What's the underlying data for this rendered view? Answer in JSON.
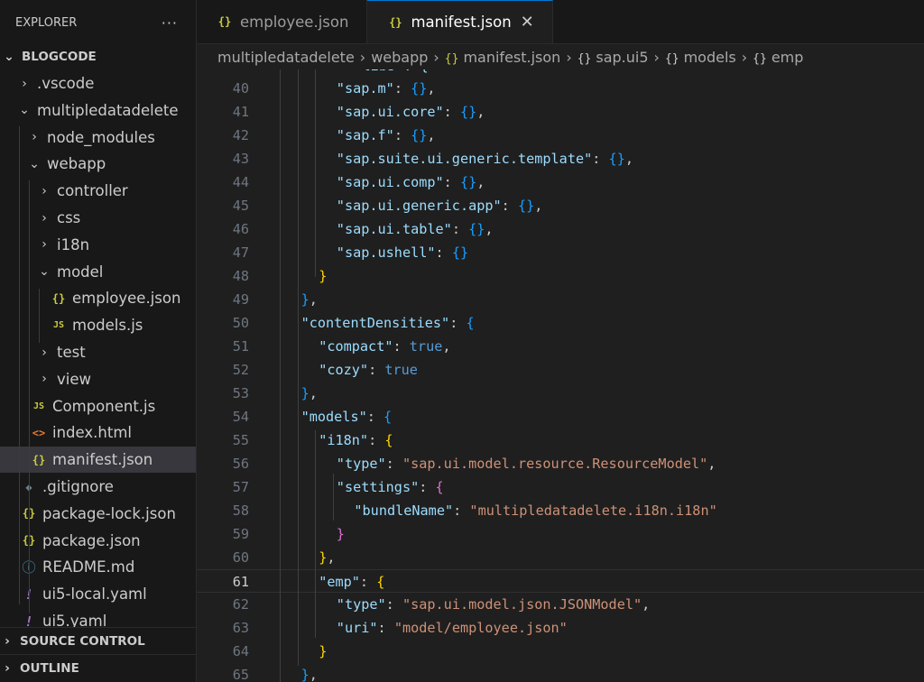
{
  "explorer": {
    "title": "EXPLORER",
    "more_label": "···",
    "root_label": "BLOGCODE",
    "items": [
      {
        "label": ".vscode",
        "kind": "folder",
        "expanded": false
      },
      {
        "label": "multipledatadelete",
        "kind": "folder",
        "expanded": true
      },
      {
        "label": "node_modules",
        "kind": "folder",
        "expanded": false
      },
      {
        "label": "webapp",
        "kind": "folder",
        "expanded": true
      },
      {
        "label": "controller",
        "kind": "folder",
        "expanded": false
      },
      {
        "label": "css",
        "kind": "folder",
        "expanded": false
      },
      {
        "label": "i18n",
        "kind": "folder",
        "expanded": false
      },
      {
        "label": "model",
        "kind": "folder",
        "expanded": true
      },
      {
        "label": "employee.json",
        "kind": "json",
        "icon": "{}"
      },
      {
        "label": "models.js",
        "kind": "js",
        "icon": "JS"
      },
      {
        "label": "test",
        "kind": "folder",
        "expanded": false
      },
      {
        "label": "view",
        "kind": "folder",
        "expanded": false
      },
      {
        "label": "Component.js",
        "kind": "js",
        "icon": "JS"
      },
      {
        "label": "index.html",
        "kind": "html",
        "icon": "<>"
      },
      {
        "label": "manifest.json",
        "kind": "json",
        "icon": "{}",
        "selected": true
      },
      {
        "label": ".gitignore",
        "kind": "git",
        "icon": "◆"
      },
      {
        "label": "package-lock.json",
        "kind": "json",
        "icon": "{}"
      },
      {
        "label": "package.json",
        "kind": "json",
        "icon": "{}"
      },
      {
        "label": "README.md",
        "kind": "info",
        "icon": "ⓘ"
      },
      {
        "label": "ui5-local.yaml",
        "kind": "yaml",
        "icon": "!"
      },
      {
        "label": "ui5.yaml",
        "kind": "yaml",
        "icon": "!"
      }
    ],
    "source_control_label": "SOURCE CONTROL",
    "outline_label": "OUTLINE"
  },
  "tabs": [
    {
      "label": "employee.json",
      "icon": "{}",
      "active": false
    },
    {
      "label": "manifest.json",
      "icon": "{}",
      "active": true,
      "close": "✕"
    }
  ],
  "breadcrumb": {
    "segments": [
      "multipledatadelete",
      "webapp",
      "manifest.json",
      "sap.ui5",
      "models",
      "emp"
    ],
    "icons": [
      "",
      "",
      "{}",
      "{}",
      "{}",
      "{}"
    ],
    "separator": "›"
  },
  "editor": {
    "top_partial": "\"libs\": {",
    "current_line": 61,
    "lines": [
      {
        "n": "40",
        "indent": 3,
        "tokens": [
          [
            "k",
            "\"sap.m\""
          ],
          [
            "p",
            ": "
          ],
          [
            "b3",
            "{}"
          ],
          [
            "p",
            ","
          ]
        ]
      },
      {
        "n": "41",
        "indent": 3,
        "tokens": [
          [
            "k",
            "\"sap.ui.core\""
          ],
          [
            "p",
            ": "
          ],
          [
            "b3",
            "{}"
          ],
          [
            "p",
            ","
          ]
        ]
      },
      {
        "n": "42",
        "indent": 3,
        "tokens": [
          [
            "k",
            "\"sap.f\""
          ],
          [
            "p",
            ": "
          ],
          [
            "b3",
            "{}"
          ],
          [
            "p",
            ","
          ]
        ]
      },
      {
        "n": "43",
        "indent": 3,
        "tokens": [
          [
            "k",
            "\"sap.suite.ui.generic.template\""
          ],
          [
            "p",
            ": "
          ],
          [
            "b3",
            "{}"
          ],
          [
            "p",
            ","
          ]
        ]
      },
      {
        "n": "44",
        "indent": 3,
        "tokens": [
          [
            "k",
            "\"sap.ui.comp\""
          ],
          [
            "p",
            ": "
          ],
          [
            "b3",
            "{}"
          ],
          [
            "p",
            ","
          ]
        ]
      },
      {
        "n": "45",
        "indent": 3,
        "tokens": [
          [
            "k",
            "\"sap.ui.generic.app\""
          ],
          [
            "p",
            ": "
          ],
          [
            "b3",
            "{}"
          ],
          [
            "p",
            ","
          ]
        ]
      },
      {
        "n": "46",
        "indent": 3,
        "tokens": [
          [
            "k",
            "\"sap.ui.table\""
          ],
          [
            "p",
            ": "
          ],
          [
            "b3",
            "{}"
          ],
          [
            "p",
            ","
          ]
        ]
      },
      {
        "n": "47",
        "indent": 3,
        "tokens": [
          [
            "k",
            "\"sap.ushell\""
          ],
          [
            "p",
            ": "
          ],
          [
            "b3",
            "{}"
          ]
        ]
      },
      {
        "n": "48",
        "indent": 2,
        "tokens": [
          [
            "b1",
            "}"
          ]
        ]
      },
      {
        "n": "49",
        "indent": 1,
        "tokens": [
          [
            "b3",
            "}"
          ],
          [
            "p",
            ","
          ]
        ]
      },
      {
        "n": "50",
        "indent": 1,
        "tokens": [
          [
            "k",
            "\"contentDensities\""
          ],
          [
            "p",
            ": "
          ],
          [
            "b3",
            "{"
          ]
        ]
      },
      {
        "n": "51",
        "indent": 2,
        "tokens": [
          [
            "k",
            "\"compact\""
          ],
          [
            "p",
            ": "
          ],
          [
            "kw",
            "true"
          ],
          [
            "p",
            ","
          ]
        ]
      },
      {
        "n": "52",
        "indent": 2,
        "tokens": [
          [
            "k",
            "\"cozy\""
          ],
          [
            "p",
            ": "
          ],
          [
            "kw",
            "true"
          ]
        ]
      },
      {
        "n": "53",
        "indent": 1,
        "tokens": [
          [
            "b3",
            "}"
          ],
          [
            "p",
            ","
          ]
        ]
      },
      {
        "n": "54",
        "indent": 1,
        "tokens": [
          [
            "k",
            "\"models\""
          ],
          [
            "p",
            ": "
          ],
          [
            "b3",
            "{"
          ]
        ]
      },
      {
        "n": "55",
        "indent": 2,
        "tokens": [
          [
            "k",
            "\"i18n\""
          ],
          [
            "p",
            ": "
          ],
          [
            "b1",
            "{"
          ]
        ]
      },
      {
        "n": "56",
        "indent": 3,
        "tokens": [
          [
            "k",
            "\"type\""
          ],
          [
            "p",
            ": "
          ],
          [
            "s",
            "\"sap.ui.model.resource.ResourceModel\""
          ],
          [
            "p",
            ","
          ]
        ]
      },
      {
        "n": "57",
        "indent": 3,
        "tokens": [
          [
            "k",
            "\"settings\""
          ],
          [
            "p",
            ": "
          ],
          [
            "b2",
            "{"
          ]
        ]
      },
      {
        "n": "58",
        "indent": 4,
        "tokens": [
          [
            "k",
            "\"bundleName\""
          ],
          [
            "p",
            ": "
          ],
          [
            "s",
            "\"multipledatadelete.i18n.i18n\""
          ]
        ]
      },
      {
        "n": "59",
        "indent": 3,
        "tokens": [
          [
            "b2",
            "}"
          ]
        ]
      },
      {
        "n": "60",
        "indent": 2,
        "tokens": [
          [
            "b1",
            "}"
          ],
          [
            "p",
            ","
          ]
        ]
      },
      {
        "n": "61",
        "indent": 2,
        "tokens": [
          [
            "k",
            "\"emp\""
          ],
          [
            "p",
            ": "
          ],
          [
            "b1",
            "{"
          ]
        ]
      },
      {
        "n": "62",
        "indent": 3,
        "tokens": [
          [
            "k",
            "\"type\""
          ],
          [
            "p",
            ": "
          ],
          [
            "s",
            "\"sap.ui.model.json.JSONModel\""
          ],
          [
            "p",
            ","
          ]
        ]
      },
      {
        "n": "63",
        "indent": 3,
        "tokens": [
          [
            "k",
            "\"uri\""
          ],
          [
            "p",
            ": "
          ],
          [
            "s",
            "\"model/employee.json\""
          ]
        ]
      },
      {
        "n": "64",
        "indent": 2,
        "tokens": [
          [
            "b1",
            "}"
          ]
        ]
      },
      {
        "n": "65",
        "indent": 1,
        "tokens": [
          [
            "b3",
            "}"
          ],
          [
            "p",
            ","
          ]
        ]
      }
    ]
  },
  "colors": {
    "accent": "#0078d4",
    "json_icon": "#cbcb41",
    "key": "#9cdcfe",
    "string": "#ce9178",
    "keyword": "#569cd6"
  }
}
